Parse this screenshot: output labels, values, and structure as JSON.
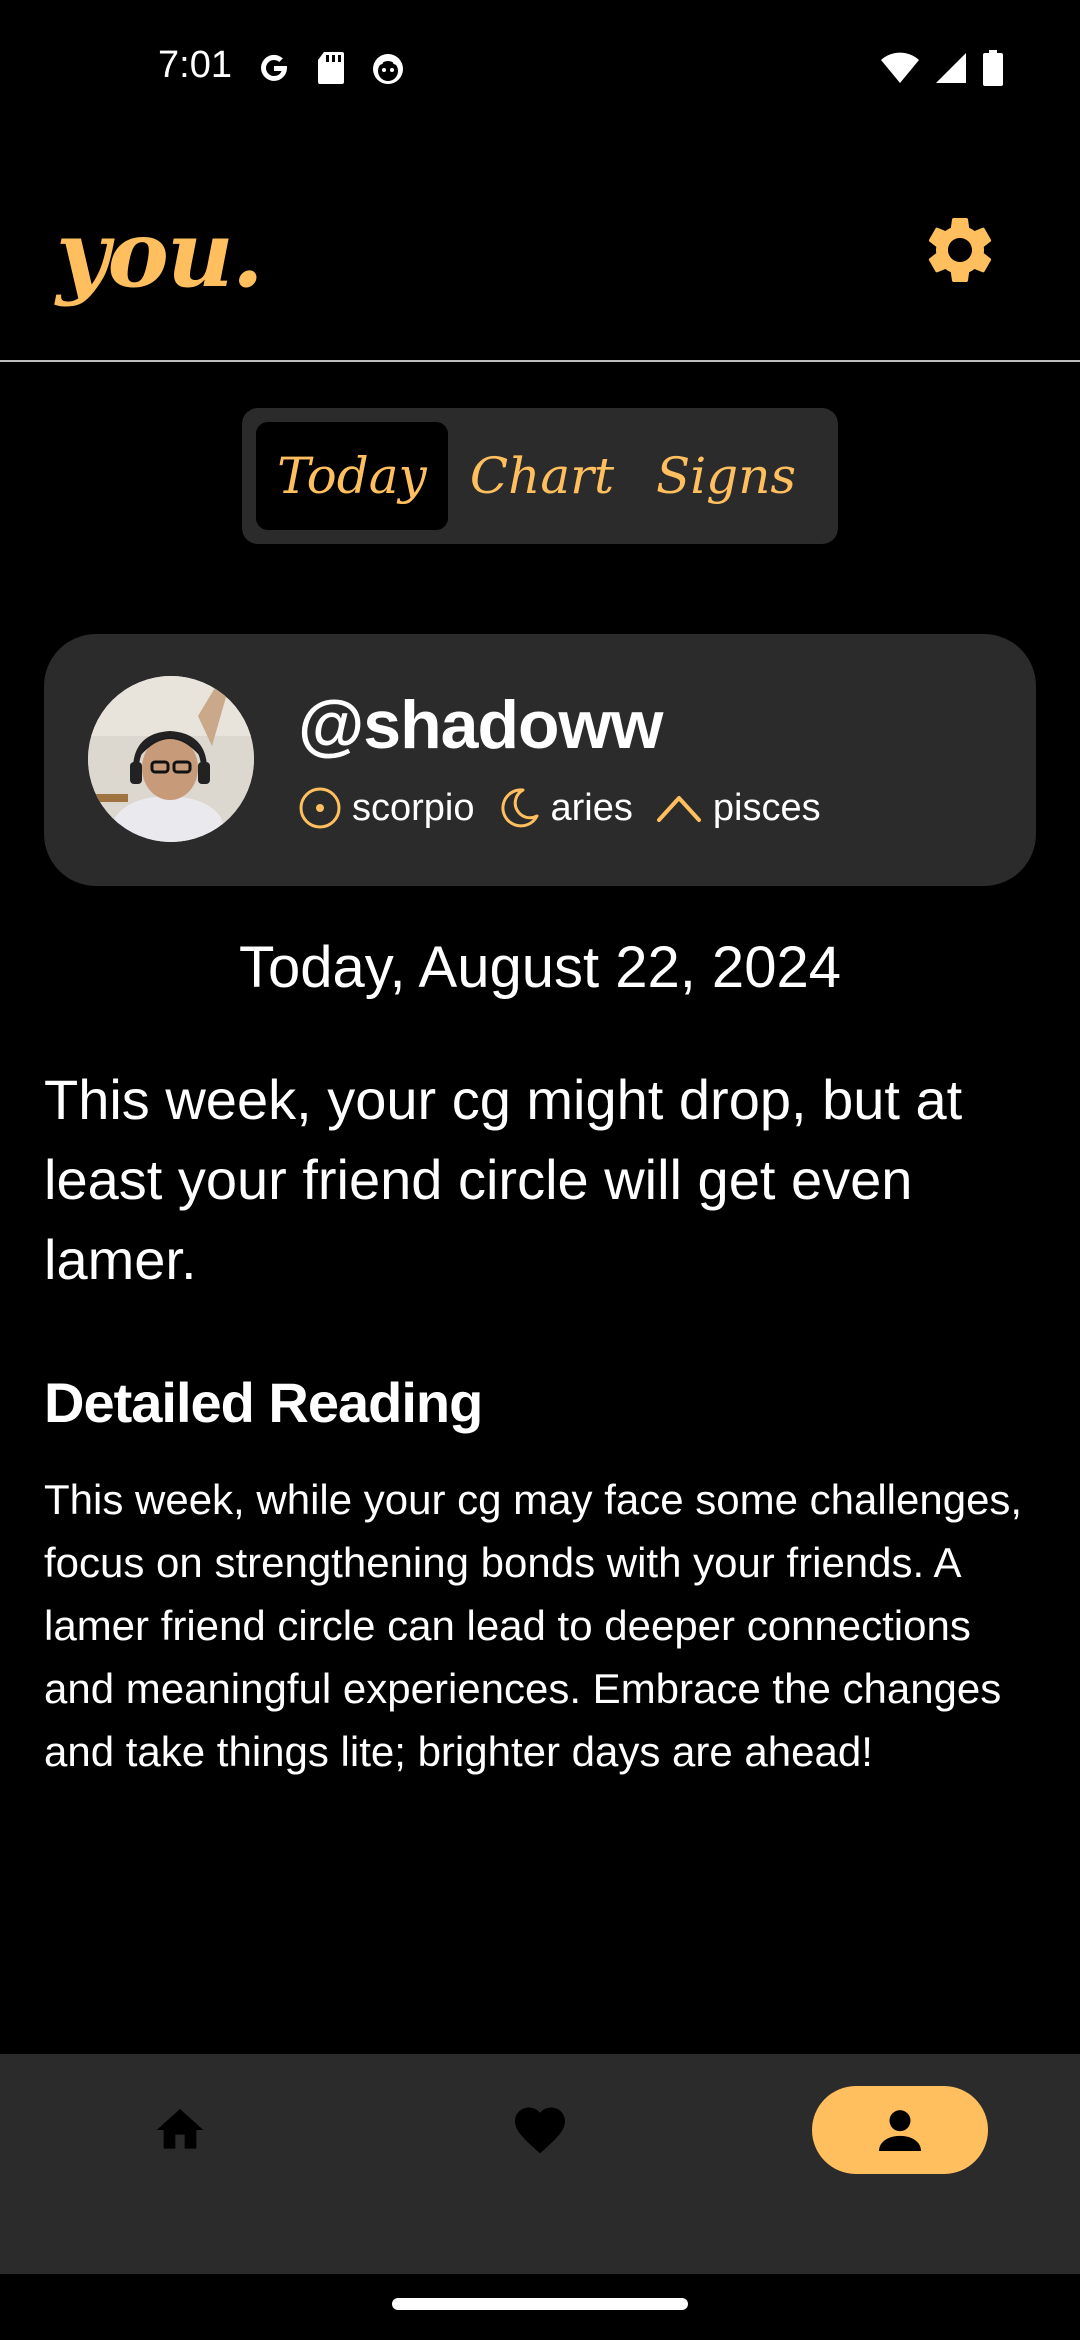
{
  "status_bar": {
    "time": "7:01",
    "left_icons": [
      "google-icon",
      "sd-card-icon",
      "cat-face-icon"
    ],
    "right_icons": [
      "wifi-icon",
      "signal-icon",
      "battery-icon"
    ]
  },
  "header": {
    "logo": "you.",
    "settings_icon": "gear-icon"
  },
  "tabs": [
    {
      "label": "Today",
      "active": true
    },
    {
      "label": "Chart",
      "active": false
    },
    {
      "label": "Signs",
      "active": false
    }
  ],
  "profile": {
    "username": "@shadoww",
    "sun": {
      "icon": "sun-icon",
      "sign": "scorpio"
    },
    "moon": {
      "icon": "moon-icon",
      "sign": "aries"
    },
    "rising": {
      "icon": "rising-icon",
      "sign": "pisces"
    }
  },
  "reading": {
    "date": "Today, August 22, 2024",
    "summary": "This week, your cg might drop, but at least your friend circle will get even lamer.",
    "detail_heading": "Detailed Reading",
    "detail_text": "This week, while your cg may face some challenges, focus on strengthening bonds with your friends. A lamer friend circle can lead to deeper connections and meaningful experiences. Embrace the changes and take things lite; brighter days are ahead!"
  },
  "bottom_nav": {
    "items": [
      {
        "icon": "home-icon",
        "active": false
      },
      {
        "icon": "heart-icon",
        "active": false
      },
      {
        "icon": "person-icon",
        "active": true
      }
    ]
  },
  "colors": {
    "accent": "#ffbf5e",
    "background": "#000000",
    "surface": "#2b2b2b"
  }
}
